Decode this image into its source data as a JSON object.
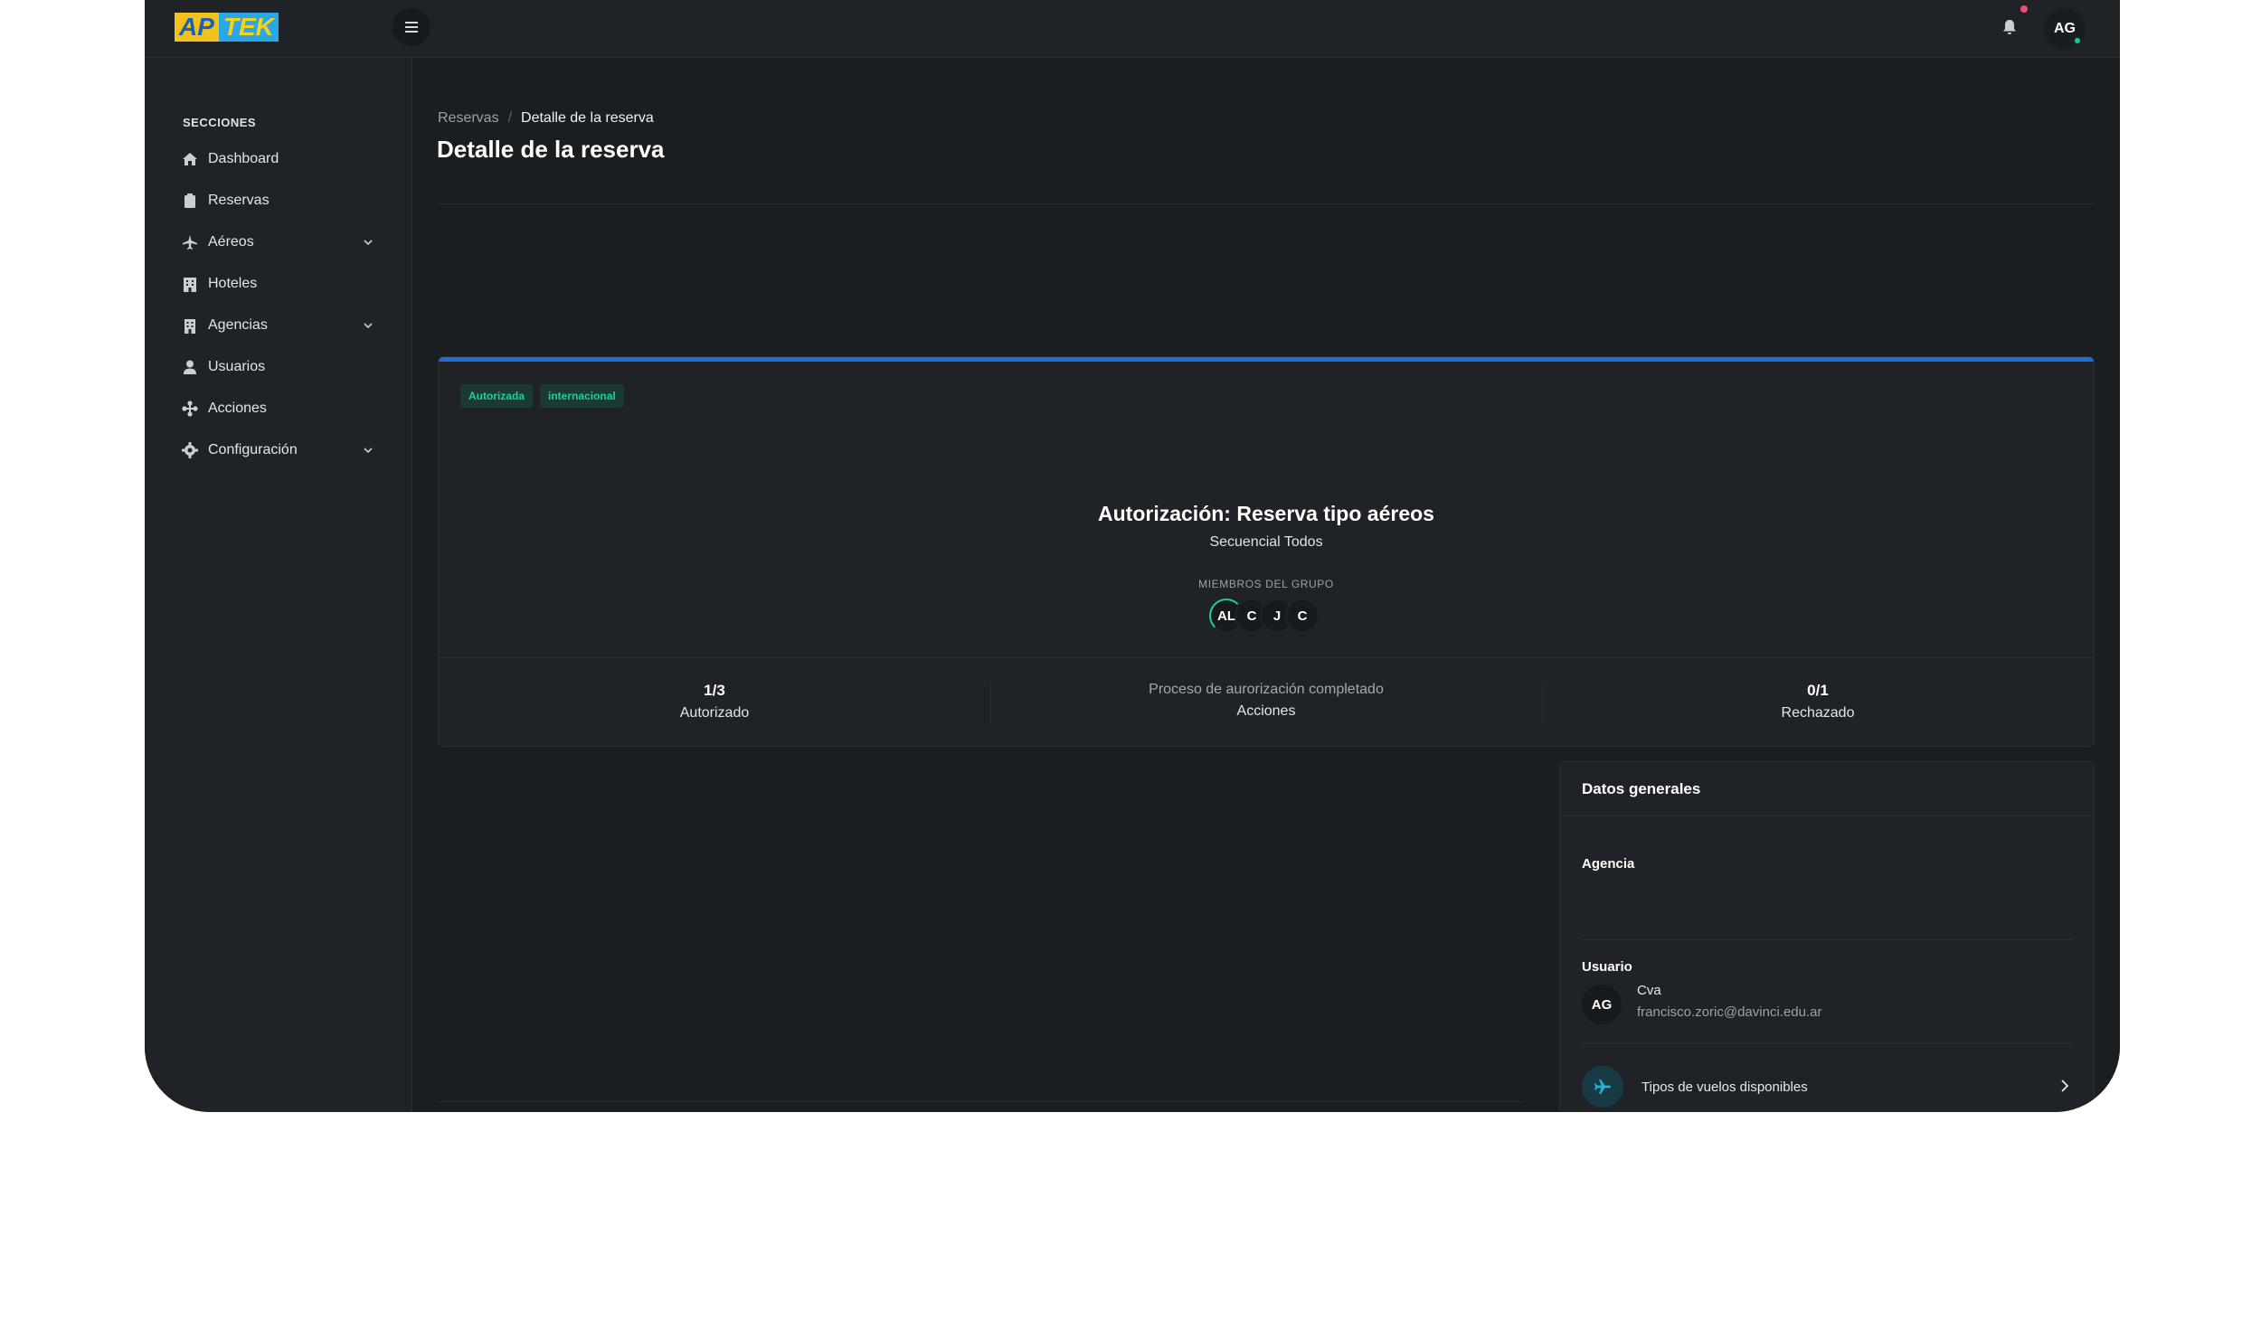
{
  "app": {
    "logo_part1": "AP",
    "logo_part2": "TEK",
    "user_initials": "AG"
  },
  "sidebar": {
    "heading": "SECCIONES",
    "items": [
      {
        "label": "Dashboard",
        "icon": "home-icon"
      },
      {
        "label": "Reservas",
        "icon": "clipboard-icon"
      },
      {
        "label": "Aéreos",
        "icon": "plane-icon",
        "expandable": true
      },
      {
        "label": "Hoteles",
        "icon": "hotel-icon"
      },
      {
        "label": "Agencias",
        "icon": "building-icon",
        "expandable": true
      },
      {
        "label": "Usuarios",
        "icon": "user-icon"
      },
      {
        "label": "Acciones",
        "icon": "actions-icon"
      },
      {
        "label": "Configuración",
        "icon": "gear-icon",
        "expandable": true
      }
    ]
  },
  "breadcrumb": {
    "parent": "Reservas",
    "current": "Detalle de la reserva"
  },
  "page": {
    "title": "Detalle de la reserva"
  },
  "authorization": {
    "badges": [
      "Autorizada",
      "internacional"
    ],
    "title": "Autorización: Reserva tipo aéreos",
    "subtitle": "Secuencial Todos",
    "members_label": "MIEMBROS DEL GRUPO",
    "members": [
      "AL",
      "C",
      "J",
      "C"
    ],
    "stats": [
      {
        "value": "1/3",
        "label": "Autorizado"
      },
      {
        "value": "Proceso de aurorización completado",
        "label": "Acciones"
      },
      {
        "value": "0/1",
        "label": "Rechazado"
      }
    ]
  },
  "general": {
    "title": "Datos generales",
    "agency_label": "Agencia",
    "user_label": "Usuario",
    "user_initials": "AG",
    "user_name": "Cva",
    "user_email": "francisco.zoric@davinci.edu.ar",
    "flights_label": "Tipos de vuelos disponibles"
  },
  "colors": {
    "background": "#1b1e21",
    "panel": "#1f2327",
    "accent_blue": "#1f6fd6",
    "badge_green": "#1fcf95",
    "notification": "#f0506e"
  }
}
